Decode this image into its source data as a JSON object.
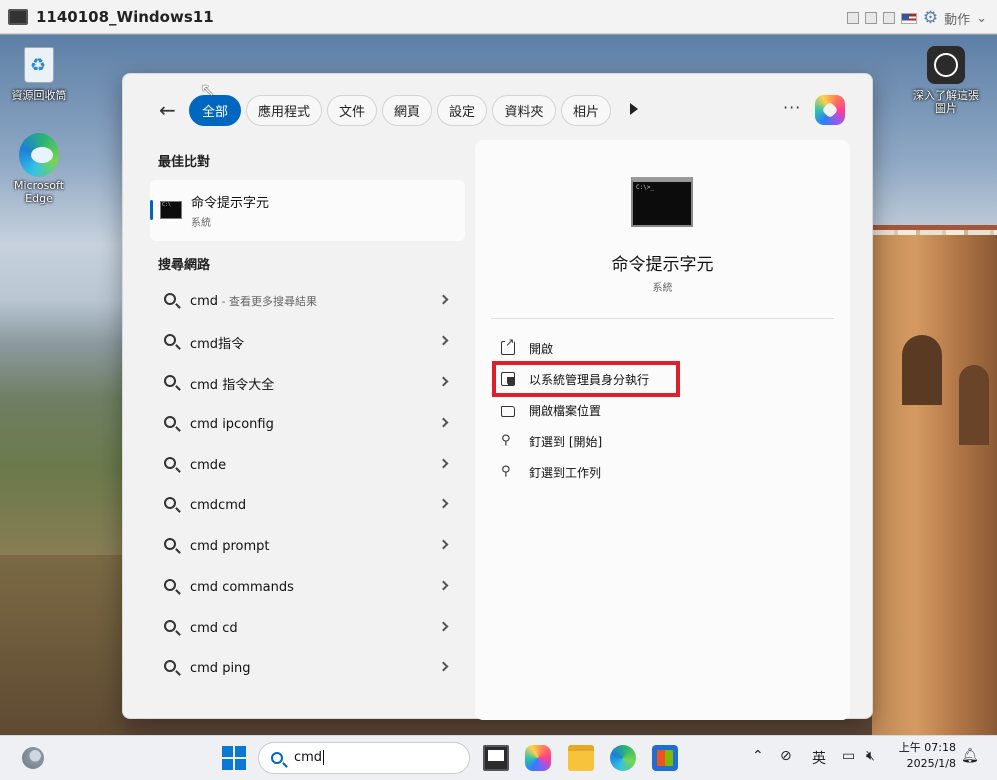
{
  "vm": {
    "title": "1140108_Windows11",
    "action_label": "動作"
  },
  "desktop": {
    "icons": [
      {
        "label": "資源回收筒"
      },
      {
        "label": "Microsoft Edge"
      },
      {
        "label": "深入了解這張圖片"
      }
    ]
  },
  "search_panel": {
    "tabs": [
      "全部",
      "應用程式",
      "文件",
      "網頁",
      "設定",
      "資料夾",
      "相片"
    ],
    "active_tab": "全部",
    "more_label": "···",
    "best_match": {
      "section_title": "最佳比對",
      "name": "命令提示字元",
      "type": "系統"
    },
    "web_search": {
      "section_title": "搜尋網路",
      "items": [
        {
          "text": "cmd",
          "hint": " - 查看更多搜尋結果"
        },
        {
          "text": "cmd指令",
          "hint": ""
        },
        {
          "text": "cmd 指令大全",
          "hint": ""
        },
        {
          "text": "cmd ipconfig",
          "hint": ""
        },
        {
          "text": "cmde",
          "hint": ""
        },
        {
          "text": "cmdcmd",
          "hint": ""
        },
        {
          "text": "cmd prompt",
          "hint": ""
        },
        {
          "text": "cmd commands",
          "hint": ""
        },
        {
          "text": "cmd cd",
          "hint": ""
        },
        {
          "text": "cmd ping",
          "hint": ""
        }
      ]
    },
    "detail": {
      "title": "命令提示字元",
      "subtitle": "系統",
      "actions": [
        {
          "label": "開啟",
          "icon": "open-icon"
        },
        {
          "label": "以系統管理員身分執行",
          "icon": "admin-shield-icon"
        },
        {
          "label": "開啟檔案位置",
          "icon": "folder-icon"
        },
        {
          "label": "釘選到 [開始]",
          "icon": "pin-icon"
        },
        {
          "label": "釘選到工作列",
          "icon": "pin-icon"
        }
      ],
      "highlight_color": "#e21e2b"
    }
  },
  "taskbar": {
    "search_text": "cmd",
    "ime": "英",
    "time": "上午 07:18",
    "date": "2025/1/8"
  },
  "colors": {
    "accent": "#0067c0"
  }
}
